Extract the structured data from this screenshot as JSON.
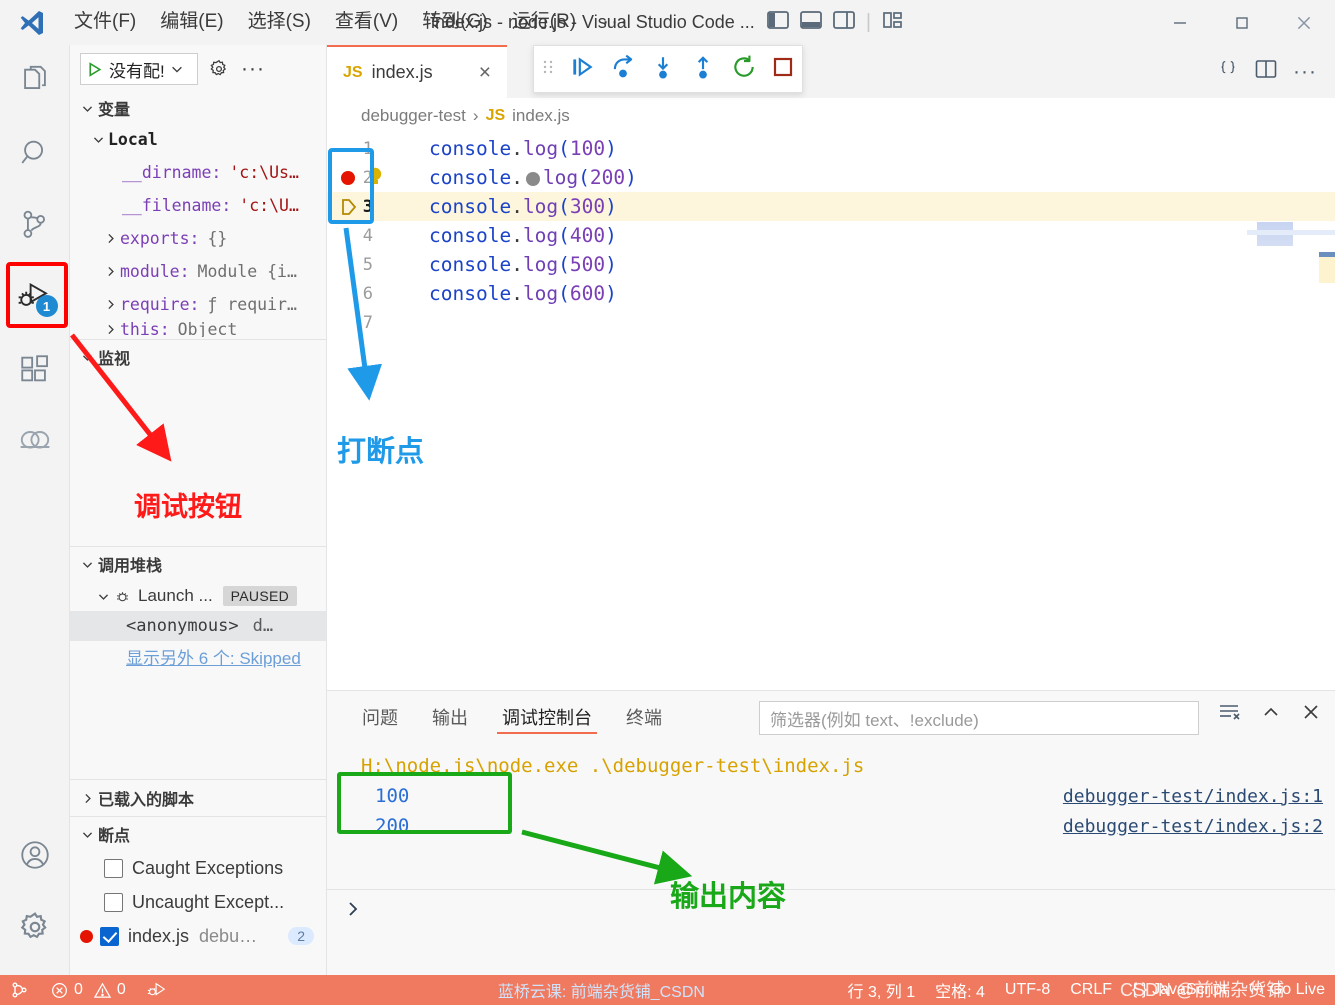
{
  "titlebar": {
    "logo_icon": "vscode-logo-icon",
    "menus": [
      "文件(F)",
      "编辑(E)",
      "选择(S)",
      "查看(V)",
      "转到(G)",
      "运行(R)"
    ],
    "overflow": "···",
    "window_title": "index.js - node.js - Visual Studio Code ...",
    "layout_icons": [
      "toggle-primary-sidebar-icon",
      "toggle-panel-icon",
      "toggle-secondary-sidebar-icon",
      "customize-layout-icon"
    ],
    "window_controls": [
      "minimize-icon",
      "maximize-icon",
      "close-icon"
    ]
  },
  "activitybar": {
    "items": [
      {
        "name": "explorer",
        "icon": "files-icon"
      },
      {
        "name": "search",
        "icon": "search-icon"
      },
      {
        "name": "source-control",
        "icon": "source-control-icon"
      },
      {
        "name": "run-and-debug",
        "icon": "debug-icon",
        "badge": "1",
        "active": true
      },
      {
        "name": "extensions",
        "icon": "extensions-icon"
      },
      {
        "name": "remote",
        "icon": "remote-icon"
      }
    ],
    "bottom_items": [
      {
        "name": "accounts",
        "icon": "account-icon"
      },
      {
        "name": "settings",
        "icon": "gear-icon"
      }
    ]
  },
  "sidebar": {
    "launch": {
      "play_icon": "play-icon",
      "value": "没有配!",
      "chevron_icon": "chevron-down-icon",
      "gear_icon": "gear-icon",
      "more_icon": "more-actions-icon"
    },
    "variables": {
      "title": "变量",
      "scope": "Local",
      "rows": [
        {
          "name": "__dirname:",
          "value": "'c:\\Us…",
          "kind": "string",
          "twisty": ""
        },
        {
          "name": "__filename:",
          "value": "'c:\\U…",
          "kind": "string",
          "twisty": ""
        },
        {
          "name": "exports:",
          "value": "{}",
          "kind": "plain",
          "twisty": "›"
        },
        {
          "name": "module:",
          "value": "Module {i…",
          "kind": "plain",
          "twisty": "›"
        },
        {
          "name": "require:",
          "value": "ƒ requir…",
          "kind": "plain",
          "twisty": "›"
        },
        {
          "name": "this:",
          "value": "Object",
          "kind": "plain",
          "twisty": "›"
        }
      ]
    },
    "watch": {
      "title": "监视"
    },
    "callstack": {
      "title": "调用堆栈",
      "session": "Launch ...",
      "session_icon": "debug-session-icon",
      "state_badge": "PAUSED",
      "frames": [
        {
          "label": "<anonymous>",
          "detail": "d…",
          "selected": true
        }
      ],
      "more_link": "显示另外 6 个: Skipped"
    },
    "loaded_scripts": {
      "title": "已载入的脚本"
    },
    "breakpoints": {
      "title": "断点",
      "items": [
        {
          "label": "Caught Exceptions",
          "checked": false,
          "dot": false,
          "detail": "",
          "count": ""
        },
        {
          "label": "Uncaught Except...",
          "checked": false,
          "dot": false,
          "detail": "",
          "count": ""
        },
        {
          "label": "index.js",
          "checked": true,
          "dot": true,
          "detail": "debu…",
          "count": "2"
        }
      ]
    }
  },
  "editor": {
    "tab": {
      "badge": "JS",
      "label": "index.js",
      "close_icon": "close-icon"
    },
    "tab_actions": [
      "format-brackets-icon",
      "split-editor-icon",
      "more-actions-icon"
    ],
    "breadcrumb": {
      "folder": "debugger-test",
      "separator": "›",
      "badge": "JS",
      "file": "index.js"
    },
    "lines": [
      {
        "num": "1",
        "obj": "console",
        "dot": ".",
        "fn": "log",
        "open": "(",
        "num_arg": "100",
        "close": ")",
        "active": false,
        "breakpoint": false,
        "lamp": false
      },
      {
        "num": "2",
        "obj": "console",
        "dot": ".",
        "fn": "log",
        "open": "(",
        "num_arg": "200",
        "close": ")",
        "active": false,
        "breakpoint": true,
        "lamp": true
      },
      {
        "num": "3",
        "obj": "console",
        "dot": ".",
        "fn": "log",
        "open": "(",
        "num_arg": "300",
        "close": ")",
        "active": true,
        "breakpoint": false,
        "lamp": false
      },
      {
        "num": "4",
        "obj": "console",
        "dot": ".",
        "fn": "log",
        "open": "(",
        "num_arg": "400",
        "close": ")",
        "active": false,
        "breakpoint": false,
        "lamp": false
      },
      {
        "num": "5",
        "obj": "console",
        "dot": ".",
        "fn": "log",
        "open": "(",
        "num_arg": "500",
        "close": ")",
        "active": false,
        "breakpoint": false,
        "lamp": false
      },
      {
        "num": "6",
        "obj": "console",
        "dot": ".",
        "fn": "log",
        "open": "(",
        "num_arg": "600",
        "close": ")",
        "active": false,
        "breakpoint": false,
        "lamp": false
      },
      {
        "num": "7",
        "obj": "",
        "dot": "",
        "fn": "",
        "open": "",
        "num_arg": "",
        "close": "",
        "active": false,
        "breakpoint": false,
        "lamp": false
      }
    ]
  },
  "debug_toolbar": {
    "drag_icon": "drag-handle-icon",
    "buttons": [
      {
        "name": "continue",
        "icon": "continue-icon"
      },
      {
        "name": "step-over",
        "icon": "step-over-icon"
      },
      {
        "name": "step-into",
        "icon": "step-into-icon"
      },
      {
        "name": "step-out",
        "icon": "step-out-icon"
      },
      {
        "name": "restart",
        "icon": "restart-icon"
      },
      {
        "name": "stop",
        "icon": "stop-icon"
      }
    ]
  },
  "panel": {
    "tabs": [
      {
        "label": "问题",
        "active": false
      },
      {
        "label": "输出",
        "active": false
      },
      {
        "label": "调试控制台",
        "active": true
      },
      {
        "label": "终端",
        "active": false
      }
    ],
    "filter_placeholder": "筛选器(例如 text、!exclude)",
    "actions": [
      "clear-console-icon",
      "chevron-up-icon",
      "close-icon"
    ],
    "console_lines": [
      {
        "text": "H:\\node.js\\node.exe .\\debugger-test\\index.js",
        "color": "orange",
        "link": ""
      },
      {
        "text": "100",
        "color": "blue",
        "link": "debugger-test/index.js:1"
      },
      {
        "text": "200",
        "color": "blue",
        "link": "debugger-test/index.js:2"
      }
    ],
    "prompt_icon": "chevron-right-icon"
  },
  "statusbar": {
    "remote_icon": "remote-window-icon",
    "errors_icon": "error-icon",
    "errors": "0",
    "warnings_icon": "warning-icon",
    "warnings": "0",
    "debug_icon": "debug-alt-icon",
    "center_text": "蓝桥云课: 前端杂货铺_CSDN",
    "line_col": "行 3, 列 1",
    "spaces": "空格: 4",
    "encoding": "UTF-8",
    "eol": "CRLF",
    "lang_icon": "braces-icon",
    "language": "JavaScript",
    "golive_icon": "broadcast-icon",
    "golive": "Go Live"
  },
  "annotations": {
    "debug_button_label": "调试按钮",
    "debug_button_color": "#ff1a1a",
    "breakpoint_label": "打断点",
    "breakpoint_color": "#1f9ae8",
    "output_label": "输出内容",
    "output_color": "#18a818",
    "highlight_red": "#ff0000",
    "highlight_blue": "#1f9ae8",
    "highlight_green": "#18a818"
  },
  "watermark": {
    "text": "CSDN @前端杂货铺"
  }
}
